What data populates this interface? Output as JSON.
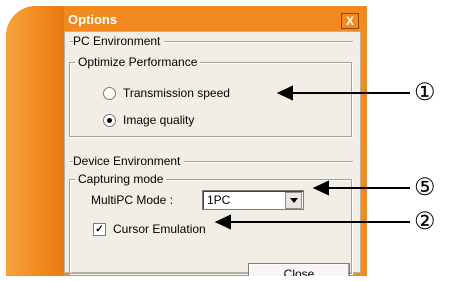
{
  "window": {
    "title": "Options",
    "close_glyph": "X",
    "colors": {
      "frame": "#f28a1f",
      "client": "#f1eee6"
    }
  },
  "pc_environment": {
    "header": "PC Environment",
    "group_label": "Optimize Performance",
    "options": [
      {
        "label": "Transmission speed",
        "selected": false
      },
      {
        "label": "Image quality",
        "selected": true
      }
    ]
  },
  "device_environment": {
    "header": "Device Environment",
    "group_label": "Capturing mode",
    "multipc_label": "MultiPC Mode :",
    "multipc_value": "1PC",
    "cursor_emulation_label": "Cursor Emulation",
    "cursor_emulation_checked": true
  },
  "buttons": {
    "close": "Close"
  },
  "annotations": [
    {
      "marker": "①"
    },
    {
      "marker": "⑤"
    },
    {
      "marker": "②"
    }
  ]
}
